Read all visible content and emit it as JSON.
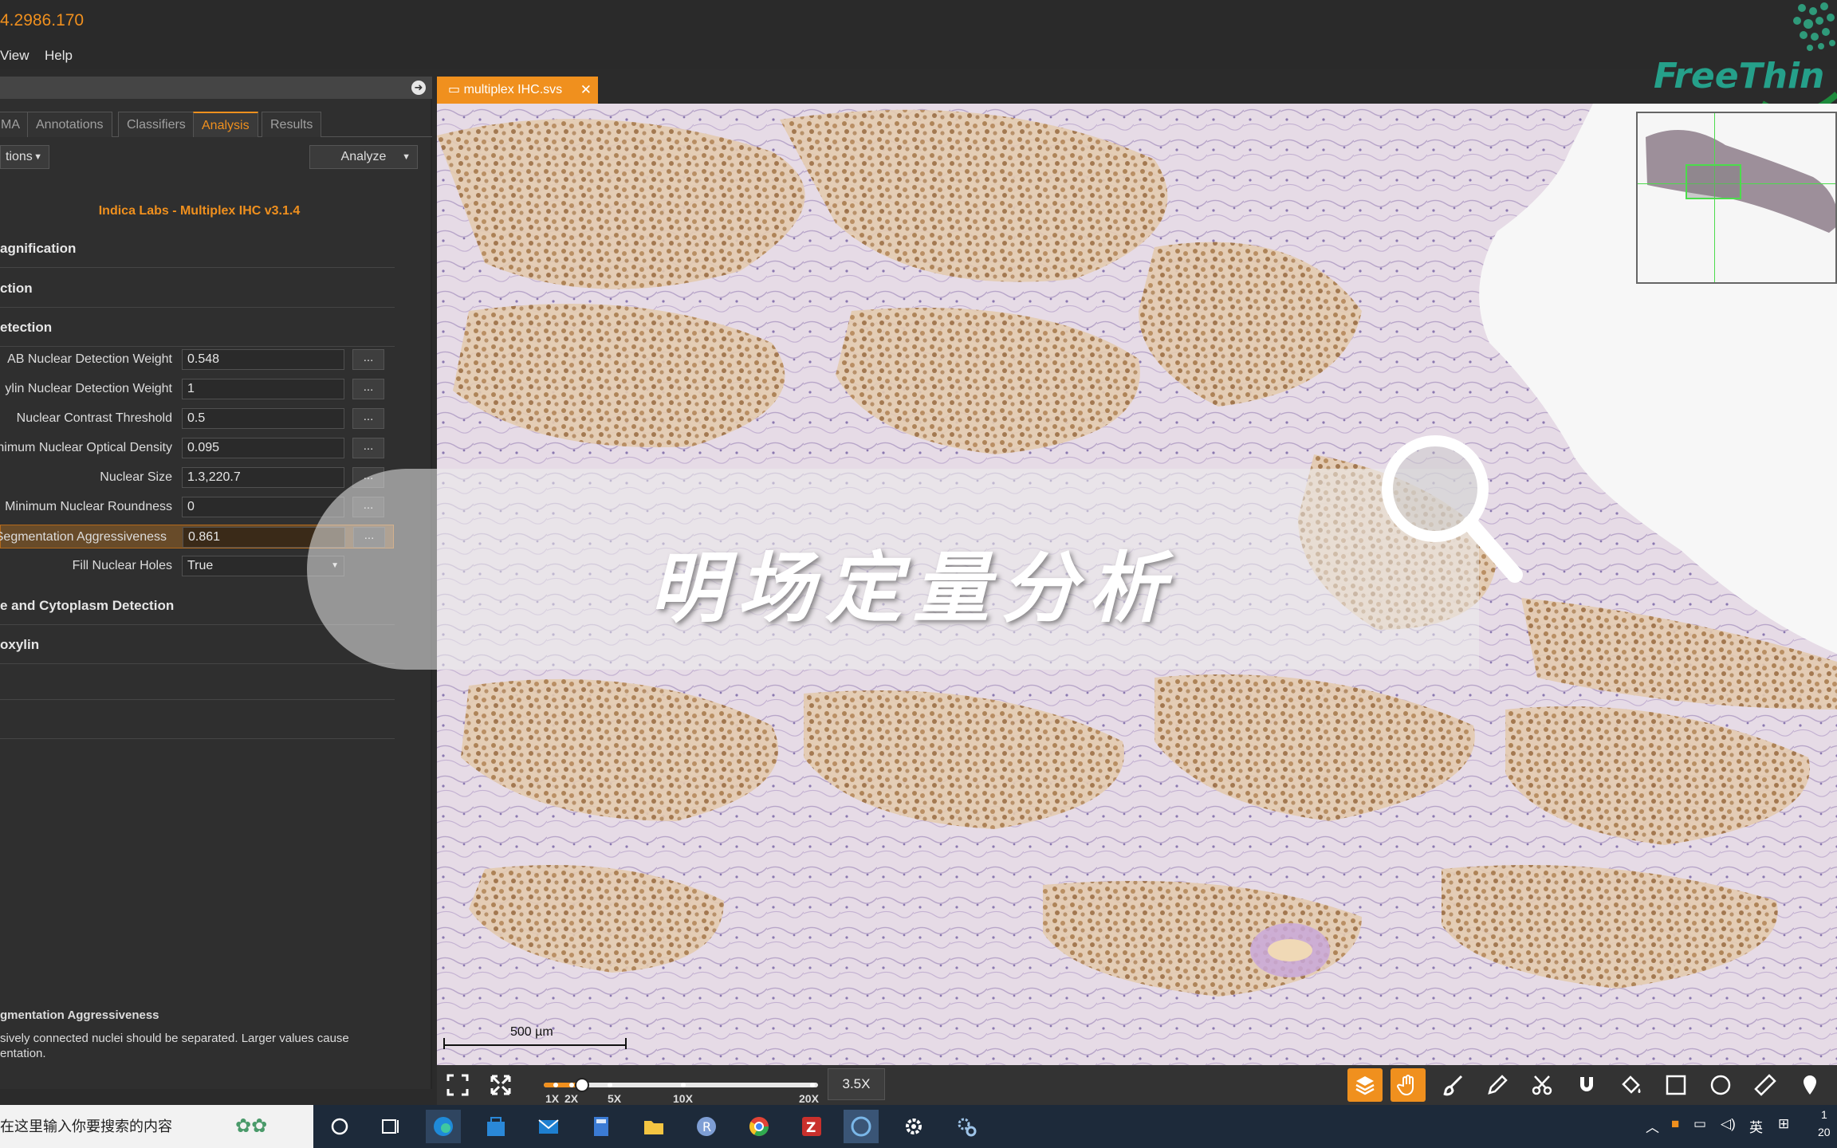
{
  "window": {
    "title": "4.2986.170"
  },
  "menu": {
    "items": [
      "View",
      "Help"
    ]
  },
  "panel": {
    "tabs": [
      "MA",
      "Annotations",
      "Classifiers",
      "Analysis",
      "Results"
    ],
    "active_tab": "Analysis",
    "actions_combo": "tions",
    "analyze_combo": "Analyze",
    "algorithm": "Indica Labs - Multiplex IHC v3.1.4",
    "sections": {
      "magnification": "agnification",
      "detection": "ction",
      "nuclear_detection": "etection",
      "membrane": "e and Cytoplasm Detection",
      "hematoxylin": "oxylin"
    },
    "params": [
      {
        "label": "AB Nuclear Detection Weight",
        "value": "0.548"
      },
      {
        "label": "ylin Nuclear Detection Weight",
        "value": "1"
      },
      {
        "label": "Nuclear Contrast Threshold",
        "value": "0.5"
      },
      {
        "label": "nimum Nuclear Optical Density",
        "value": "0.095"
      },
      {
        "label": "Nuclear Size",
        "value": "1.3,220.7"
      },
      {
        "label": "Minimum Nuclear Roundness",
        "value": "0"
      },
      {
        "label": "Segmentation Aggressiveness",
        "value": "0.861"
      }
    ],
    "fill_holes": {
      "label": "Fill Nuclear Holes",
      "value": "True"
    },
    "ellipsis": "...",
    "help_title": "gmentation Aggressiveness",
    "help_line1": "sively connected nuclei should be separated.  Larger values cause",
    "help_line2": "entation."
  },
  "viewer": {
    "doc_tab": "multiplex IHC.svs",
    "close_glyph": "✕",
    "overlay_title": "明场定量分析",
    "scale_label": "500 µm",
    "zoom": "3.5X",
    "zoom_fraction": 0.14,
    "zoom_ticks": [
      "1X",
      "2X",
      "5X",
      "10X",
      "20X"
    ]
  },
  "logo": {
    "text": "FreeThin"
  },
  "taskbar": {
    "search_placeholder": "在这里输入你要搜索的内容",
    "ime": "英",
    "clock_time": "1",
    "clock_date": "20"
  },
  "colors": {
    "accent": "#f0901e",
    "panel": "#2f2f2f",
    "overview_box": "#4cdc4c"
  }
}
